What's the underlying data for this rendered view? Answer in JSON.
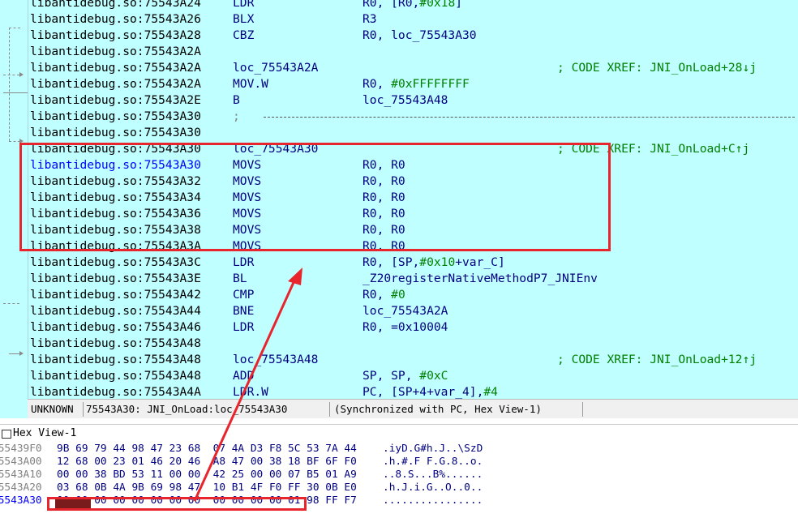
{
  "disassembly": {
    "lines": [
      {
        "addr": "libantidebug.so:75543A24",
        "mnem": "LDR",
        "ops": "R0, [R0,#0x18]",
        "comment": ""
      },
      {
        "addr": "libantidebug.so:75543A26",
        "mnem": "BLX",
        "ops": "R3",
        "comment": ""
      },
      {
        "addr": "libantidebug.so:75543A28",
        "mnem": "CBZ",
        "ops": "R0, loc_75543A30",
        "comment": ""
      },
      {
        "addr": "libantidebug.so:75543A2A",
        "mnem": "",
        "ops": "",
        "comment": ""
      },
      {
        "addr": "libantidebug.so:75543A2A",
        "mnem": "loc_75543A2A",
        "ops": "",
        "comment": "; CODE XREF: JNI_OnLoad+28↓j"
      },
      {
        "addr": "libantidebug.so:75543A2A",
        "mnem": "MOV.W",
        "ops": "R0, #0xFFFFFFFF",
        "comment": ""
      },
      {
        "addr": "libantidebug.so:75543A2E",
        "mnem": "B",
        "ops": "loc_75543A48",
        "comment": ""
      },
      {
        "addr": "libantidebug.so:75543A30",
        "mnem": ";",
        "ops": "",
        "comment": "",
        "separator": true
      },
      {
        "addr": "libantidebug.so:75543A30",
        "mnem": "",
        "ops": "",
        "comment": ""
      },
      {
        "addr": "libantidebug.so:75543A30",
        "mnem": "loc_75543A30",
        "ops": "",
        "comment": "; CODE XREF: JNI_OnLoad+C↑j"
      },
      {
        "addr": "libantidebug.so:75543A30",
        "mnem": "MOVS",
        "ops": "R0, R0",
        "comment": "",
        "current": true
      },
      {
        "addr": "libantidebug.so:75543A32",
        "mnem": "MOVS",
        "ops": "R0, R0",
        "comment": ""
      },
      {
        "addr": "libantidebug.so:75543A34",
        "mnem": "MOVS",
        "ops": "R0, R0",
        "comment": ""
      },
      {
        "addr": "libantidebug.so:75543A36",
        "mnem": "MOVS",
        "ops": "R0, R0",
        "comment": ""
      },
      {
        "addr": "libantidebug.so:75543A38",
        "mnem": "MOVS",
        "ops": "R0, R0",
        "comment": ""
      },
      {
        "addr": "libantidebug.so:75543A3A",
        "mnem": "MOVS",
        "ops": "R0, R0",
        "comment": ""
      },
      {
        "addr": "libantidebug.so:75543A3C",
        "mnem": "LDR",
        "ops": "R0, [SP,#0x10+var_C]",
        "comment": ""
      },
      {
        "addr": "libantidebug.so:75543A3E",
        "mnem": "BL",
        "ops": "_Z20registerNativeMethodP7_JNIEnv",
        "comment": ""
      },
      {
        "addr": "libantidebug.so:75543A42",
        "mnem": "CMP",
        "ops": "R0, #0",
        "comment": ""
      },
      {
        "addr": "libantidebug.so:75543A44",
        "mnem": "BNE",
        "ops": "loc_75543A2A",
        "comment": ""
      },
      {
        "addr": "libantidebug.so:75543A46",
        "mnem": "LDR",
        "ops": "R0, =0x10004",
        "comment": ""
      },
      {
        "addr": "libantidebug.so:75543A48",
        "mnem": "",
        "ops": "",
        "comment": ""
      },
      {
        "addr": "libantidebug.so:75543A48",
        "mnem": "loc_75543A48",
        "ops": "",
        "comment": "; CODE XREF: JNI_OnLoad+12↑j"
      },
      {
        "addr": "libantidebug.so:75543A48",
        "mnem": "ADD",
        "ops": "SP, SP, #0xC",
        "comment": ""
      },
      {
        "addr": "libantidebug.so:75543A4A",
        "mnem": "LDR.W",
        "ops": "PC, [SP+4+var_4],#4",
        "comment": ""
      }
    ],
    "status": {
      "segment": "UNKNOWN",
      "location": "75543A30: JNI_OnLoad:loc_75543A30",
      "sync": "(Synchronized with PC, Hex View-1)"
    }
  },
  "hexview": {
    "title": "Hex View-1",
    "rows": [
      {
        "addr": "755439F0",
        "bytes": "9B 69 79 44 98 47 23 68  07 4A D3 F8 5C 53 7A 44",
        "ascii": ".iyD.G#h.J..\\SzD"
      },
      {
        "addr": "75543A00",
        "bytes": "12 68 00 23 01 46 20 46  A8 47 00 38 18 BF 6F F0",
        "ascii": ".h.#.F F.G.8..o."
      },
      {
        "addr": "75543A10",
        "bytes": "00 00 38 BD 53 11 00 00  42 25 00 00 07 B5 01 A9",
        "ascii": "..8.S...B%......"
      },
      {
        "addr": "75543A20",
        "bytes": "03 68 0B 4A 9B 69 98 47  10 B1 4F F0 FF 30 0B E0",
        "ascii": ".h.J.i.G..O..0.."
      },
      {
        "addr": "75543A30",
        "bytes": "00 00 00 00 00 00 00 00  00 00 00 00 01 98 FF F7",
        "ascii": "................",
        "highlight": true
      }
    ]
  },
  "colors": {
    "disasm_bg": "#c0ffff",
    "annotation_red": "#e8242c",
    "address_blue": "#0000ff",
    "mnemonic_navy": "#000080",
    "comment_green": "#008000"
  }
}
